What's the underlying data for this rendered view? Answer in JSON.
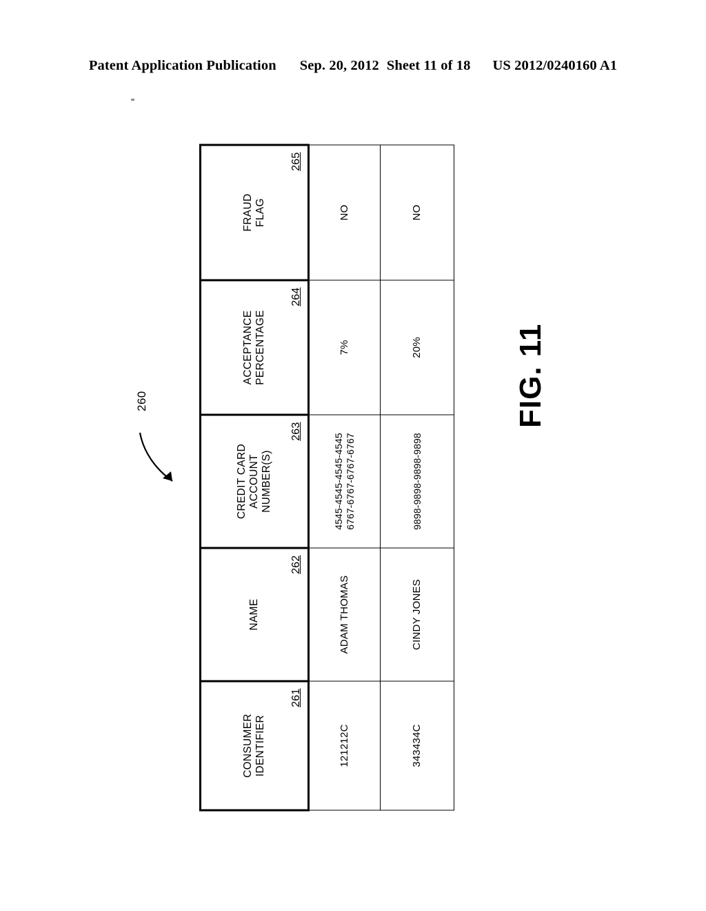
{
  "header": {
    "publication": "Patent Application Publication",
    "date": "Sep. 20, 2012",
    "sheet": "Sheet 11 of 18",
    "number": "US 2012/0240160 A1"
  },
  "figure": {
    "label": "FIG. 11",
    "callout": "260"
  },
  "table": {
    "columns": [
      {
        "ref": "261",
        "title_lines": [
          "CONSUMER",
          "IDENTIFIER"
        ]
      },
      {
        "ref": "262",
        "title_lines": [
          "NAME"
        ]
      },
      {
        "ref": "263",
        "title_lines": [
          "CREDIT CARD",
          "ACCOUNT",
          "NUMBER(S)"
        ]
      },
      {
        "ref": "264",
        "title_lines": [
          "ACCEPTANCE",
          "PERCENTAGE"
        ]
      },
      {
        "ref": "265",
        "title_lines": [
          "FRAUD",
          "FLAG"
        ]
      }
    ],
    "rows": [
      {
        "consumer_identifier": "121212C",
        "name": "ADAM THOMAS",
        "credit_card_account_numbers": [
          "4545-4545-4545-4545",
          "6767-6767-6767-6767"
        ],
        "acceptance_percentage": "7%",
        "fraud_flag": "NO"
      },
      {
        "consumer_identifier": "343434C",
        "name": "CINDY JONES",
        "credit_card_account_numbers": [
          "9898-9898-9898-9898"
        ],
        "acceptance_percentage": "20%",
        "fraud_flag": "NO"
      }
    ]
  },
  "colors": {
    "ink": "#000000",
    "page": "#ffffff"
  }
}
